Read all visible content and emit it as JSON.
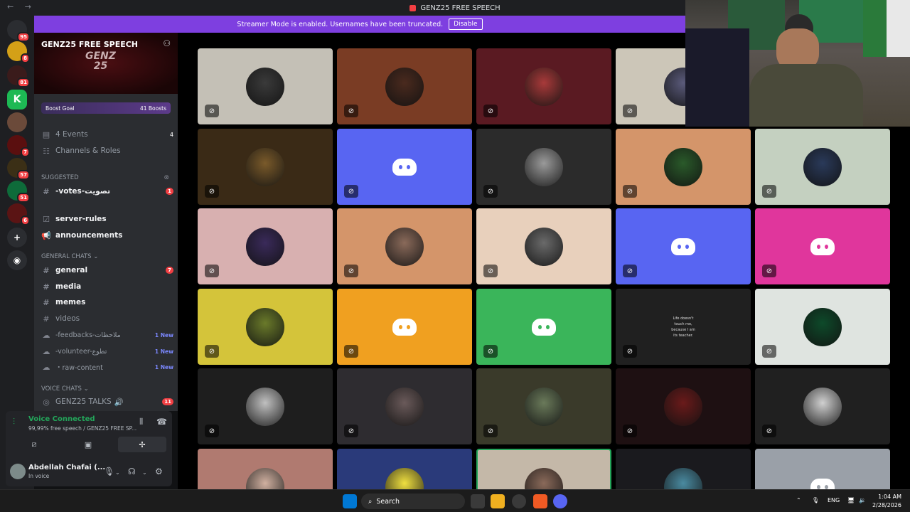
{
  "window": {
    "title": "GENZ25 FREE SPEECH",
    "nav": "← →"
  },
  "streamer_bar": {
    "text": "Streamer Mode is enabled. Usernames have been truncated.",
    "button": "Disable"
  },
  "servers": [
    {
      "badge": "95",
      "color": "#2b2d31"
    },
    {
      "badge": "8",
      "color": "#d4a017"
    },
    {
      "badge": "81",
      "color": "#3a1b1b"
    },
    {
      "badge": "",
      "color": "#1db954"
    },
    {
      "badge": "",
      "color": "#6b4a3a"
    },
    {
      "badge": "7",
      "color": "#5a0f0f"
    },
    {
      "badge": "57",
      "color": "#3b2f16"
    },
    {
      "badge": "51",
      "color": "#0e6b3a"
    },
    {
      "badge": "6",
      "color": "#5a1414"
    }
  ],
  "server": {
    "name": "GENZ25 FREE SPEECH",
    "banner_logo": "GENZ\n25"
  },
  "boost": {
    "label": "Boost Goal",
    "count": "41 Boosts"
  },
  "events": {
    "label": "4 Events",
    "count": "4"
  },
  "channels_roles": "Channels & Roles",
  "suggested": {
    "label": "Suggested",
    "channel": "-votes-تصويت",
    "badge": "1"
  },
  "top_channels": [
    "server-rules",
    "announcements"
  ],
  "general_chats": {
    "label": "GENERAL CHATS",
    "channels": [
      {
        "name": "general",
        "badge": "7",
        "bold": true
      },
      {
        "name": "media",
        "badge": "",
        "bold": true
      },
      {
        "name": "memes",
        "badge": "",
        "bold": true
      },
      {
        "name": "videos",
        "badge": "",
        "bold": false
      }
    ],
    "threads": [
      {
        "name": "-feedbacks-ملاحظات",
        "tag": "1 New"
      },
      {
        "name": "-volunteer-تطوع",
        "tag": "1 New"
      },
      {
        "name": "・raw-content",
        "tag": "1 New"
      }
    ]
  },
  "voice_chats": {
    "label": "VOICE CHATS",
    "channel": "GENZ25 TALKS",
    "badge": "11"
  },
  "voice_panel": {
    "title": "Voice Connected",
    "subtitle": "99,99% free speech / GENZ25 FREE SP..."
  },
  "user": {
    "name": "Abdellah Chafai (...",
    "status": "In voice"
  },
  "tiles": [
    {
      "bg": "#c4c0b6",
      "av": "#3a3a3a"
    },
    {
      "bg": "#7a3c24",
      "av": "#4a2a1e"
    },
    {
      "bg": "#5a1a22",
      "av": "#a83a3a"
    },
    {
      "bg": "#ccc6b8",
      "av": "#5a5a7a"
    },
    {
      "bg": "#3a2a16",
      "av": "#7a5a2a"
    },
    {
      "bg": "#5865f2",
      "av": "discord"
    },
    {
      "bg": "#2b2b2b",
      "av": "#9a9a9a"
    },
    {
      "bg": "#d4956a",
      "av": "#2a5a2a"
    },
    {
      "bg": "#c4d0c0",
      "av": "#2a3a5a"
    },
    {
      "bg": "#d8b0b0",
      "av": "#3a2a5a"
    },
    {
      "bg": "#d4956a",
      "av": "#8a6a5a"
    },
    {
      "bg": "#e8d0bc",
      "av": "#6a6a6a"
    },
    {
      "bg": "#5865f2",
      "av": "discord"
    },
    {
      "bg": "#e0369c",
      "av": "discord"
    },
    {
      "bg": "#d4c43a",
      "av": "#6a7a2a"
    },
    {
      "bg": "#f0a020",
      "av": "discord"
    },
    {
      "bg": "#3ab55a",
      "av": "discord"
    },
    {
      "bg": "#202020",
      "av": "#202020"
    },
    {
      "bg": "#dfe4e0",
      "av": "#0e4a2a"
    },
    {
      "bg": "#1e1e1e",
      "av": "#c0c0c0"
    },
    {
      "bg": "#2e2c30",
      "av": "#6a5a5a"
    },
    {
      "bg": "#3a3a2a",
      "av": "#6a7a5a"
    },
    {
      "bg": "#1e1012",
      "av": "#6a1a1a"
    },
    {
      "bg": "#202020",
      "av": "#d0d0d0"
    },
    {
      "bg": "#b07a70",
      "av": "#d0b0a0"
    },
    {
      "bg": "#2a3a7a",
      "av": "#f0e040"
    },
    {
      "bg": "#c4b8a8",
      "av": "#8a6a5a"
    },
    {
      "bg": "#1a1a1e",
      "av": "#4a8aa0"
    },
    {
      "bg": "#9aa0a8",
      "av": "discord"
    }
  ],
  "tile_text": "Life doesn't touch me, because I am its teacher.",
  "taskbar": {
    "search": "Search",
    "lang": "ENG",
    "time": "1:04 AM",
    "date": "2/28/2026"
  }
}
